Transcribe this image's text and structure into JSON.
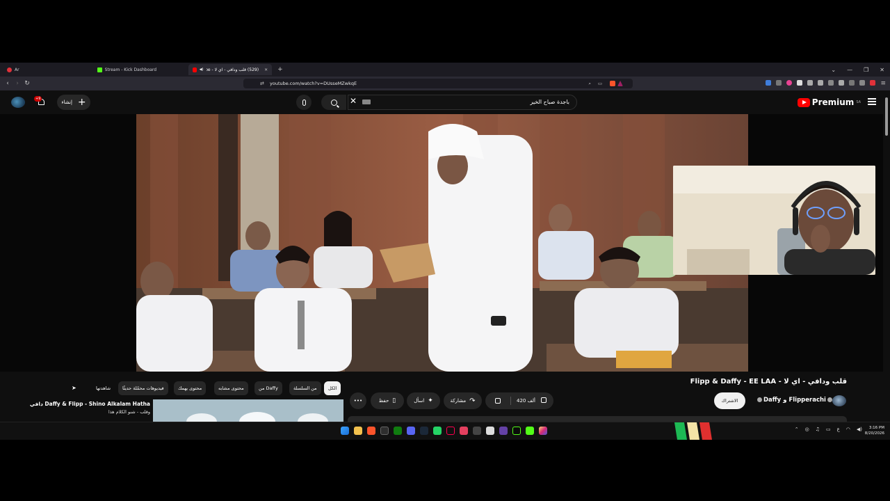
{
  "browser": {
    "tabs": [
      {
        "label": "Ar",
        "active": false
      },
      {
        "label": "Stream - Kick Dashboard",
        "active": false
      },
      {
        "label": "(529) قلب ودافي - اي لا - YouTube",
        "active": true
      }
    ],
    "url": "youtube.com/watch?v=DUsseMZwkqE"
  },
  "youtube": {
    "logo": "Premium",
    "logo_region": "SA",
    "search_query": "باجدة صباح الخير",
    "create_label": "إنشاء",
    "notifications_badge": "+9",
    "video": {
      "title": "قلب ودافي - اي لا - Flipp & Daffy - EE LAA",
      "channels": "Daffy و Flipperachi",
      "subscribe_label": "الاشتراك",
      "likes": "420 ألف",
      "share_label": "مشاركة",
      "ask_label": "اسأل",
      "save_label": "حفظ",
      "more_label": "•••"
    },
    "chips": [
      {
        "label": "الكل",
        "active": true
      },
      {
        "label": "من السلسلة",
        "active": false
      },
      {
        "label": "من Daffy",
        "active": false
      },
      {
        "label": "محتوى مشابه",
        "active": false
      },
      {
        "label": "محتوى يهمك",
        "active": false
      },
      {
        "label": "فيديوهات محمّلة حديثًا",
        "active": false
      },
      {
        "label": "شاهدتها",
        "active": false
      }
    ],
    "recommendation": {
      "title": "Daffy & Flipp - Shino Alkalam Hatha دافي",
      "subtitle": "وقلب - شنو الكلام هذا"
    }
  },
  "taskbar": {
    "time": "3:16 PM",
    "date": "8/20/2026",
    "lang": "ع"
  },
  "colors": {
    "yt_red": "#ff0000",
    "background": "#0f0f0f",
    "chip_bg": "#272727"
  }
}
